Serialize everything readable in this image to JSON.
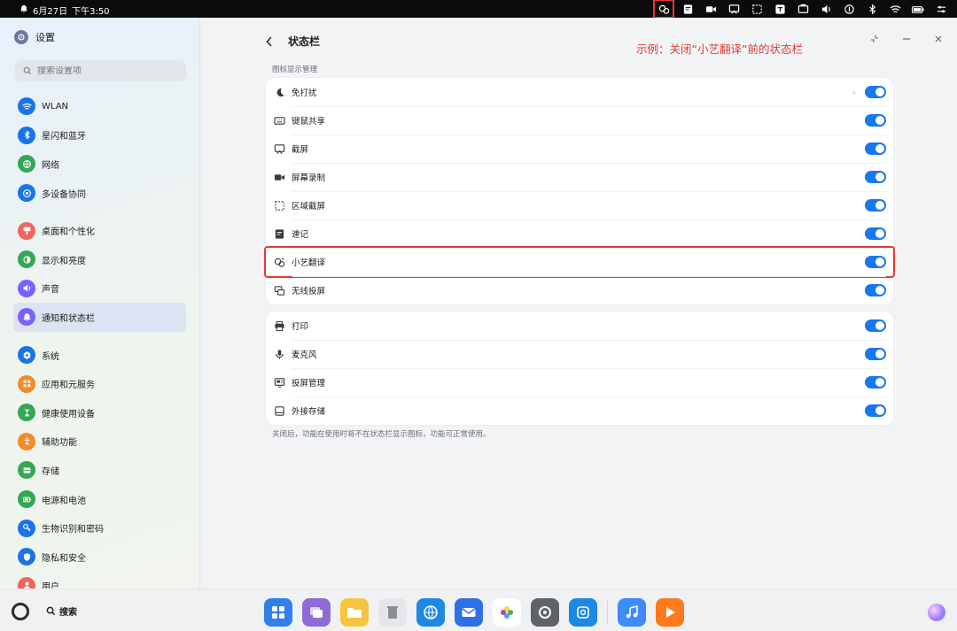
{
  "status_bar": {
    "date": "6月27日",
    "time": "下午3:50",
    "icons": [
      "bell-icon",
      "xiaoyi-translate-icon",
      "notes-icon",
      "screen-record-icon",
      "screenshot-icon",
      "area-screenshot-icon",
      "translate-icon",
      "projection-icon",
      "volume-icon",
      "bluetooth-alt-icon",
      "bluetooth-icon",
      "wifi-icon",
      "battery-icon",
      "control-center-icon"
    ]
  },
  "sidebar": {
    "title": "设置",
    "search_placeholder": "搜索设置项",
    "groups": [
      [
        {
          "label": "WLAN",
          "icon": "wifi-icon",
          "color": "#1a73e8"
        },
        {
          "label": "星闪和蓝牙",
          "icon": "bluetooth-icon",
          "color": "#1a73e8"
        },
        {
          "label": "网络",
          "icon": "globe-icon",
          "color": "#34a853"
        },
        {
          "label": "多设备协同",
          "icon": "devices-icon",
          "color": "#1a73e8"
        }
      ],
      [
        {
          "label": "桌面和个性化",
          "icon": "brush-icon",
          "color": "#f2665e"
        },
        {
          "label": "显示和亮度",
          "icon": "brightness-icon",
          "color": "#34a853"
        },
        {
          "label": "声音",
          "icon": "sound-icon",
          "color": "#7b61ff"
        },
        {
          "label": "通知和状态栏",
          "icon": "bell-icon",
          "color": "#7b61ff",
          "active": true
        }
      ],
      [
        {
          "label": "系统",
          "icon": "system-icon",
          "color": "#1a73e8"
        },
        {
          "label": "应用和元服务",
          "icon": "apps-icon",
          "color": "#f28c28"
        },
        {
          "label": "健康使用设备",
          "icon": "hourglass-icon",
          "color": "#34a853"
        },
        {
          "label": "辅助功能",
          "icon": "accessibility-icon",
          "color": "#f28c28"
        },
        {
          "label": "存储",
          "icon": "storage-icon",
          "color": "#34a853"
        },
        {
          "label": "电源和电池",
          "icon": "battery-icon",
          "color": "#34a853"
        },
        {
          "label": "生物识别和密码",
          "icon": "key-icon",
          "color": "#1a73e8"
        },
        {
          "label": "隐私和安全",
          "icon": "shield-icon",
          "color": "#1a73e8"
        },
        {
          "label": "用户",
          "icon": "user-icon",
          "color": "#f2665e"
        }
      ]
    ]
  },
  "main": {
    "title": "状态栏",
    "annotation": "示例：关闭“小艺翻译”前的状态栏",
    "section_label": "图标显示管理",
    "card1": [
      {
        "label": "免打扰",
        "icon": "moon-icon",
        "on": true,
        "chevron": true
      },
      {
        "label": "键鼠共享",
        "icon": "keyboard-mouse-icon",
        "on": true
      },
      {
        "label": "截屏",
        "icon": "screenshot-icon",
        "on": true
      },
      {
        "label": "屏幕录制",
        "icon": "screen-record-icon",
        "on": true
      },
      {
        "label": "区域截屏",
        "icon": "area-screenshot-icon",
        "on": true
      },
      {
        "label": "速记",
        "icon": "notes-icon",
        "on": true
      },
      {
        "label": "小艺翻译",
        "icon": "xiaoyi-translate-icon",
        "on": true,
        "highlight": true
      },
      {
        "label": "无线投屏",
        "icon": "wireless-projection-icon",
        "on": true
      }
    ],
    "card2": [
      {
        "label": "打印",
        "icon": "printer-icon",
        "on": true
      },
      {
        "label": "麦克风",
        "icon": "microphone-icon",
        "on": true
      },
      {
        "label": "投屏管理",
        "icon": "projection-manage-icon",
        "on": true
      },
      {
        "label": "外接存储",
        "icon": "external-storage-icon",
        "on": true
      }
    ],
    "footnote": "关闭后，功能在使用时将不在状态栏显示图标，功能可正常使用。"
  },
  "dock": {
    "search_label": "搜索",
    "apps": [
      {
        "name": "app-center-icon",
        "color": "#2f80ed"
      },
      {
        "name": "multi-window-icon",
        "color": "#8e6bd6"
      },
      {
        "name": "files-icon",
        "color": "#f5c542"
      },
      {
        "name": "trash-icon",
        "color": "#c9ccd1"
      },
      {
        "name": "browser-icon",
        "color": "#1e88e5"
      },
      {
        "name": "mail-icon",
        "color": "#2f6fe8"
      },
      {
        "name": "gallery-icon",
        "color": "#ff7a59"
      },
      {
        "name": "settings-icon",
        "color": "#5f6368"
      },
      {
        "name": "app-market-icon",
        "color": "#1e88e5"
      },
      {
        "name": "music-icon",
        "color": "#3d8bfd"
      },
      {
        "name": "video-icon",
        "color": "#ff7a1a"
      }
    ]
  },
  "colors": {
    "accent": "#1778f2",
    "annotation": "#e53935"
  }
}
